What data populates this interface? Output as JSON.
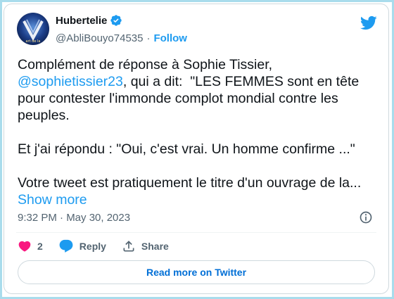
{
  "author": {
    "display_name": "Hubertelie",
    "handle": "@AbliBouyo74535",
    "separator": "·",
    "follow_label": "Follow",
    "avatar_text": "art de la",
    "verified_icon": "verified-badge-icon"
  },
  "tweet": {
    "line1": "Complément de réponse à Sophie Tissier,\n",
    "mention": "@sophietissier23",
    "line2": ", qui a dit:  \"LES FEMMES sont en tête pour contester l'immonde complot mondial contre les peuples.\n\nEt j'ai répondu : \"Oui, c'est vrai. Un homme confirme ...\"\n\nVotre tweet est pratiquement le titre d'un ouvrage de la... ",
    "show_more": "Show more"
  },
  "meta": {
    "timestamp": "9:32 PM · May 30, 2023"
  },
  "actions": {
    "like_count": "2",
    "reply_label": "Reply",
    "share_label": "Share"
  },
  "footer": {
    "read_more_label": "Read more on Twitter"
  },
  "colors": {
    "accent": "#1d9bf0",
    "like": "#f91880",
    "frame": "#a9dcec"
  }
}
